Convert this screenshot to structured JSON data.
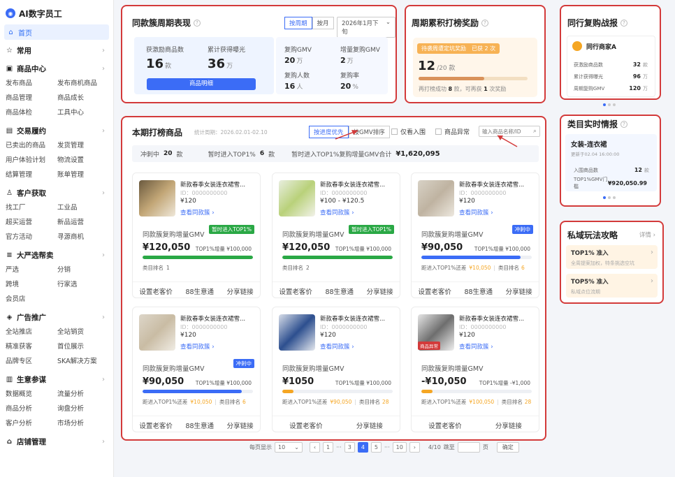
{
  "sidebar": {
    "brand": "AI数字员工",
    "home": "首页",
    "sections": [
      {
        "title": "常用",
        "icon": "star-icon",
        "items": []
      },
      {
        "title": "商品中心",
        "icon": "box-icon",
        "items": [
          "发布商品",
          "发布商机商品",
          "商品管理",
          "商品成长",
          "商品体检",
          "工具中心"
        ]
      },
      {
        "title": "交易履约",
        "icon": "clipboard-icon",
        "items": [
          "已卖出的商品",
          "发货管理",
          "用户体验计划",
          "物流设置",
          "结算管理",
          "账单管理"
        ]
      },
      {
        "title": "客户获取",
        "icon": "person-icon",
        "items": [
          "找工厂",
          "工业品",
          "超买运营",
          "新品运营",
          "官方活动",
          "寻源商机"
        ]
      },
      {
        "title": "大严选帮卖",
        "icon": "list-icon",
        "items": [
          "严选",
          "分销",
          "跨境",
          "行家选",
          "会员店"
        ]
      },
      {
        "title": "广告推广",
        "icon": "megaphone-icon",
        "items": [
          "全站推店",
          "全站销货",
          "精准获客",
          "首位展示",
          "品牌专区",
          "SKA解决方案"
        ]
      },
      {
        "title": "生意参谋",
        "icon": "chart-icon",
        "items": [
          "数据概览",
          "流量分析",
          "商品分析",
          "询盘分析",
          "客户分析",
          "市场分析"
        ]
      },
      {
        "title": "店铺管理",
        "icon": "shop-icon",
        "items": []
      }
    ]
  },
  "perf": {
    "title": "同款簇周期表现",
    "tab_cycle": "按周期",
    "tab_month": "按月",
    "period": "2026年1月下旬",
    "stats": [
      {
        "label": "获激励商品数",
        "value": "16",
        "unit": "款"
      },
      {
        "label": "累计获得曝光",
        "value": "36",
        "unit": "万"
      },
      {
        "label": "复购GMV",
        "value": "20",
        "unit": "万"
      },
      {
        "label": "增量复购GMV",
        "value": "2",
        "unit": "万"
      },
      {
        "label": "复购人数",
        "value": "16",
        "unit": "人"
      },
      {
        "label": "复购率",
        "value": "20",
        "unit": "%"
      }
    ],
    "button": "商品明细"
  },
  "reward": {
    "title": "周期累积打榜奖励",
    "banner": "待袭周遭定坑奖励",
    "banner_count": "已获 2 次",
    "count": "12",
    "count_unit": "/20 款",
    "progress": 0.6,
    "note_a": "再打榜成功",
    "note_b": "8",
    "note_c": "款，可再获",
    "note_d": "1",
    "note_e": "次奖励"
  },
  "peer": {
    "title": "同行复购战报",
    "merchant": "同行商家A",
    "rows": [
      {
        "k": "获激励商品数",
        "v": "32",
        "u": "款"
      },
      {
        "k": "累计获得曝光",
        "v": "96",
        "u": "万"
      },
      {
        "k": "周期复购GMV",
        "v": "120",
        "u": "万"
      }
    ]
  },
  "category": {
    "title": "类目实时情报",
    "name": "女装-连衣裙",
    "updated": "更新于02.04 16:00:00",
    "rows": [
      {
        "k": "入围商品数",
        "v": "12",
        "u": "款"
      },
      {
        "k": "TOP1%GMV门槛",
        "v": "¥920,050.99",
        "u": ""
      }
    ]
  },
  "private": {
    "title": "私域玩法攻略",
    "more": "详情",
    "tips": [
      {
        "t": "TOP1% 准入",
        "d": "全周提案加权，特条挑选空坑"
      },
      {
        "t": "TOP5% 准入",
        "d": "私域点位流期"
      }
    ]
  },
  "main": {
    "title": "本期打榜商品",
    "period": "统计周期：2026.02.01-02.10",
    "sort_a": "按进度优先",
    "sort_b": "按GMV排序",
    "chk_a": "仅看入围",
    "chk_b": "商品异常",
    "search_ph": "输入商品名称/ID",
    "sum_a": "冲刺中",
    "sum_a_v": "20",
    "sum_a_u": "款",
    "sum_b": "暂时进入TOP1%",
    "sum_b_v": "6",
    "sum_b_u": "款",
    "sum_c": "暂时进入TOP1%复购增量GMV合计",
    "sum_c_v": "¥1,620,095"
  },
  "products": [
    {
      "title": "新款春季女装连衣裙雪...",
      "id": "ID：0000000000",
      "price": "¥120",
      "link": "查看同款簇 ›",
      "glabel": "同款簇复购增量GMV",
      "badge": "暂时进入TOP1%",
      "gmv": "¥120,050",
      "target": "TOP1%增量 ¥100,000",
      "progress": 1.0,
      "foot1": "类目排名",
      "foot2": "1",
      "foot3": "",
      "foot4": "",
      "a1": "设置老客价",
      "a2": "88生意通",
      "a3": "分享链接"
    },
    {
      "title": "新款春季女装连衣裙雪...",
      "id": "ID：0000000000",
      "price": "¥100 - ¥120.5",
      "link": "查看同款簇 ›",
      "glabel": "同款簇复购增量GMV",
      "badge": "暂时进入TOP1%",
      "gmv": "¥120,050",
      "target": "TOP1%增量 ¥100,000",
      "progress": 1.0,
      "foot1": "类目排名",
      "foot2": "2",
      "foot3": "",
      "foot4": "",
      "a1": "设置老客价",
      "a2": "88生意通",
      "a3": "分享链接"
    },
    {
      "title": "新款春季女装连衣裙雪...",
      "id": "ID：0000000000",
      "price": "¥120",
      "link": "查看同款簇 ›",
      "glabel": "同款簇复购增量GMV",
      "badge": "冲刺中",
      "gmv": "¥90,050",
      "target": "TOP1%增量 ¥100,000",
      "progress": 0.9,
      "foot1": "距进入TOP1%还差",
      "foot2": "¥10,050",
      "foot3": "类目排名",
      "foot4": "6",
      "a1": "设置老客价",
      "a2": "88生意通",
      "a3": "分享链接"
    },
    {
      "title": "新款春季女装连衣裙雪...",
      "id": "ID：0000000000",
      "price": "¥120",
      "link": "查看同款簇 ›",
      "glabel": "同款簇复购增量GMV",
      "badge": "冲刺中",
      "gmv": "¥90,050",
      "target": "TOP1%增量 ¥100,000",
      "progress": 0.9,
      "foot1": "距进入TOP1%还差",
      "foot2": "¥10,050",
      "foot3": "类目排名",
      "foot4": "6",
      "a1": "设置老客价",
      "a2": "88生意通",
      "a3": "分享链接"
    },
    {
      "title": "新款春季女装连衣裙雪...",
      "id": "ID：0000000000",
      "price": "¥120",
      "link": "查看同款簇 ›",
      "glabel": "同款簇复购增量GMV",
      "badge": "",
      "gmv": "¥1050",
      "target": "TOP1%增量 ¥100,000",
      "progress": 0.1,
      "foot1": "距进入TOP1%还差",
      "foot2": "¥90,050",
      "foot3": "类目排名",
      "foot4": "28",
      "a1": "设置老客价",
      "a2": "",
      "a3": "分享链接"
    },
    {
      "title": "新款春季女装连衣裙雪...",
      "id": "ID：0000000000",
      "price": "¥120",
      "link": "查看同款簇 ›",
      "glabel": "同款簇复购增量GMV",
      "badge": "",
      "gmv": "-¥10,050",
      "target": "TOP1%增量 -¥1,000",
      "progress": 0.1,
      "foot1": "距进入TOP1%还差",
      "foot2": "¥100,050",
      "foot3": "类目排名",
      "foot4": "28",
      "a1": "设置老客价",
      "a2": "",
      "a3": "分享链接",
      "abnormal": "商品异常"
    }
  ],
  "pagination": {
    "per_label": "每页显示",
    "per": "10",
    "pages": [
      "1",
      "···",
      "3",
      "4",
      "5",
      "···",
      "10"
    ],
    "current": "4",
    "total": "4/10",
    "goto": "跳至",
    "page_unit": "页",
    "confirm": "确定"
  },
  "colors": {
    "accent": "#3b6cf6",
    "green": "#2aa845",
    "orange": "#f5a623",
    "highlight": "#d33a3a"
  }
}
